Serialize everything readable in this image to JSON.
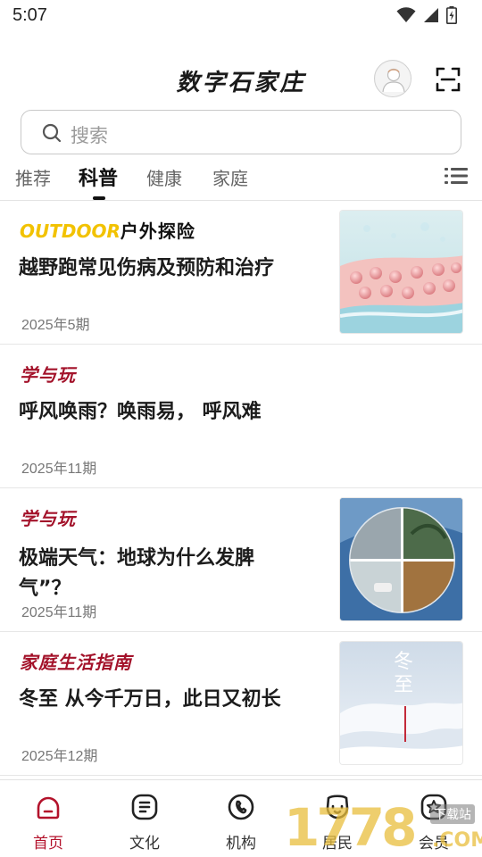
{
  "status": {
    "time": "5:07"
  },
  "header": {
    "title": "数字石家庄",
    "avatar_icon": "user-avatar-icon",
    "scan_icon": "scan-icon"
  },
  "search": {
    "placeholder": "搜索"
  },
  "tabs": {
    "items": [
      {
        "label": "推荐",
        "active": false
      },
      {
        "label": "科普",
        "active": true
      },
      {
        "label": "健康",
        "active": false
      },
      {
        "label": "家庭",
        "active": false
      }
    ],
    "menu_icon": "list-menu-icon"
  },
  "articles": [
    {
      "column": "户外探险",
      "column_brand": "OUTDOOR",
      "title": "越野跑常见伤病及预防和治疗",
      "issue": "2025年5期",
      "has_thumb": true
    },
    {
      "column": "学与玩",
      "title": "呼风唤雨？唤雨易， 呼风难",
      "issue": "2025年11期",
      "has_thumb": false
    },
    {
      "column": "学与玩",
      "title": "极端天气：地球为什么发脾气”？",
      "issue": "2025年11期",
      "has_thumb": true
    },
    {
      "column": "家庭生活指南",
      "title": "冬至 从今千万日，此日又初长",
      "issue": "2025年12期",
      "has_thumb": true,
      "thumb_text": "冬至"
    }
  ],
  "bottom_nav": {
    "items": [
      {
        "label": "首页",
        "icon": "home-icon",
        "active": true
      },
      {
        "label": "文化",
        "icon": "culture-icon",
        "active": false
      },
      {
        "label": "机构",
        "icon": "organization-icon",
        "active": false
      },
      {
        "label": "居民",
        "icon": "resident-icon",
        "active": false
      },
      {
        "label": "会员",
        "icon": "member-icon",
        "active": false
      }
    ]
  },
  "watermark": {
    "text": "1778",
    "subtext": "下载站",
    "suffix": ".COM"
  },
  "colors": {
    "accent": "#b3122b",
    "brand_yellow": "#f2c200"
  }
}
